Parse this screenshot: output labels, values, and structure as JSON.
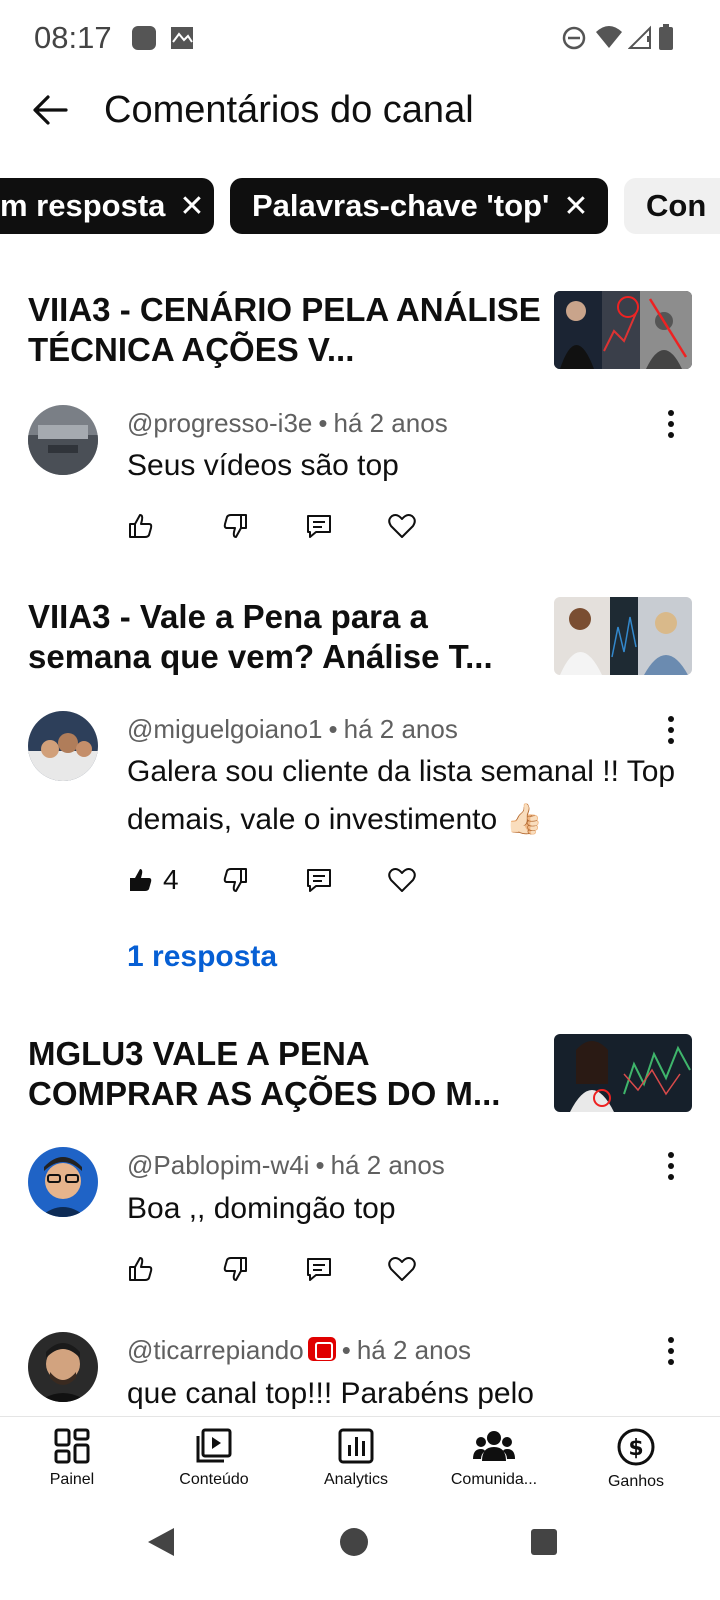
{
  "status_bar": {
    "time": "08:17"
  },
  "header": {
    "title": "Comentários do canal"
  },
  "chips": [
    {
      "label": "m resposta",
      "close": "✕"
    },
    {
      "label": "Palavras-chave 'top'",
      "close": "✕"
    },
    {
      "label": "Con"
    }
  ],
  "comments": [
    {
      "video_title": "VIIA3 - CENÁRIO PELA ANÁLISE TÉCNICA AÇÕES V...",
      "author": "@progresso-i3e",
      "time": "há 2 anos",
      "text": "Seus vídeos são top",
      "likes": ""
    },
    {
      "video_title": "VIIA3 - Vale a Pena para a semana que vem? Análise T...",
      "author": "@miguelgoiano1",
      "time": "há 2 anos",
      "text": "Galera sou cliente da lista semanal !! Top demais, vale o investimento 👍🏻",
      "likes": "4",
      "replies": "1 resposta"
    },
    {
      "video_title": "MGLU3 VALE A PENA COMPRAR AS AÇÕES DO M...",
      "author": "@Pablopim-w4i",
      "time": "há 2 anos",
      "text": "Boa ,, domingão top",
      "likes": ""
    },
    {
      "author": "@ticarrepiando",
      "time": "há 2 anos",
      "text": "que canal top!!! Parabéns pelo"
    }
  ],
  "separator": "•",
  "bottom_nav": [
    {
      "label": "Painel",
      "icon": "dashboard-icon"
    },
    {
      "label": "Conteúdo",
      "icon": "content-icon"
    },
    {
      "label": "Analytics",
      "icon": "analytics-icon"
    },
    {
      "label": "Comunida...",
      "icon": "community-icon"
    },
    {
      "label": "Ganhos",
      "icon": "earnings-icon"
    }
  ]
}
